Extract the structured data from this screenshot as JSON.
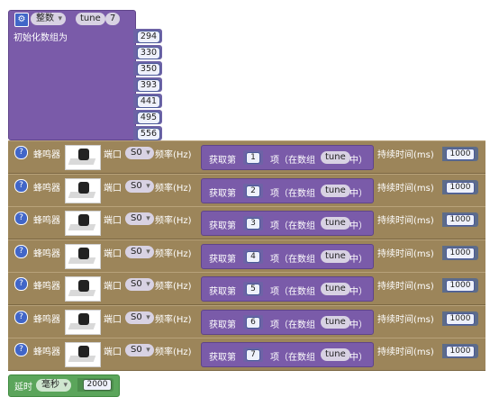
{
  "array_block": {
    "type_value": "整数",
    "var_name": "tune",
    "size": "7",
    "init_label": "初始化数组为",
    "values": [
      "294",
      "330",
      "350",
      "393",
      "441",
      "495",
      "556"
    ]
  },
  "buzzer_rows": [
    {
      "label": "蜂鸣器",
      "port_label": "端口",
      "port_value": "S0",
      "freq_label": "频率(Hz)",
      "get_prefix": "获取第",
      "index": "1",
      "get_middle": "项（在数组",
      "array_name": "tune",
      "get_suffix": "中）",
      "duration_label": "持续时间(ms)",
      "duration_value": "1000"
    },
    {
      "label": "蜂鸣器",
      "port_label": "端口",
      "port_value": "S0",
      "freq_label": "频率(Hz)",
      "get_prefix": "获取第",
      "index": "2",
      "get_middle": "项（在数组",
      "array_name": "tune",
      "get_suffix": "中）",
      "duration_label": "持续时间(ms)",
      "duration_value": "1000"
    },
    {
      "label": "蜂鸣器",
      "port_label": "端口",
      "port_value": "S0",
      "freq_label": "频率(Hz)",
      "get_prefix": "获取第",
      "index": "3",
      "get_middle": "项（在数组",
      "array_name": "tune",
      "get_suffix": "中）",
      "duration_label": "持续时间(ms)",
      "duration_value": "1000"
    },
    {
      "label": "蜂鸣器",
      "port_label": "端口",
      "port_value": "S0",
      "freq_label": "频率(Hz)",
      "get_prefix": "获取第",
      "index": "4",
      "get_middle": "项（在数组",
      "array_name": "tune",
      "get_suffix": "中）",
      "duration_label": "持续时间(ms)",
      "duration_value": "1000"
    },
    {
      "label": "蜂鸣器",
      "port_label": "端口",
      "port_value": "S0",
      "freq_label": "频率(Hz)",
      "get_prefix": "获取第",
      "index": "5",
      "get_middle": "项（在数组",
      "array_name": "tune",
      "get_suffix": "中）",
      "duration_label": "持续时间(ms)",
      "duration_value": "1000"
    },
    {
      "label": "蜂鸣器",
      "port_label": "端口",
      "port_value": "S0",
      "freq_label": "频率(Hz)",
      "get_prefix": "获取第",
      "index": "6",
      "get_middle": "项（在数组",
      "array_name": "tune",
      "get_suffix": "中）",
      "duration_label": "持续时间(ms)",
      "duration_value": "1000"
    },
    {
      "label": "蜂鸣器",
      "port_label": "端口",
      "port_value": "S0",
      "freq_label": "频率(Hz)",
      "get_prefix": "获取第",
      "index": "7",
      "get_middle": "项（在数组",
      "array_name": "tune",
      "get_suffix": "中）",
      "duration_label": "持续时间(ms)",
      "duration_value": "1000"
    }
  ],
  "delay_block": {
    "label": "延时",
    "unit": "毫秒",
    "value": "2000"
  },
  "icons": {
    "gear": "gear-icon",
    "help": "question-icon",
    "buzzer": "buzzer-module-image"
  },
  "colors": {
    "array_purple": "#7a5ba9",
    "buzzer_brown": "#9c855a",
    "delay_green": "#5ba55b",
    "accent_blue": "#4166c8"
  }
}
